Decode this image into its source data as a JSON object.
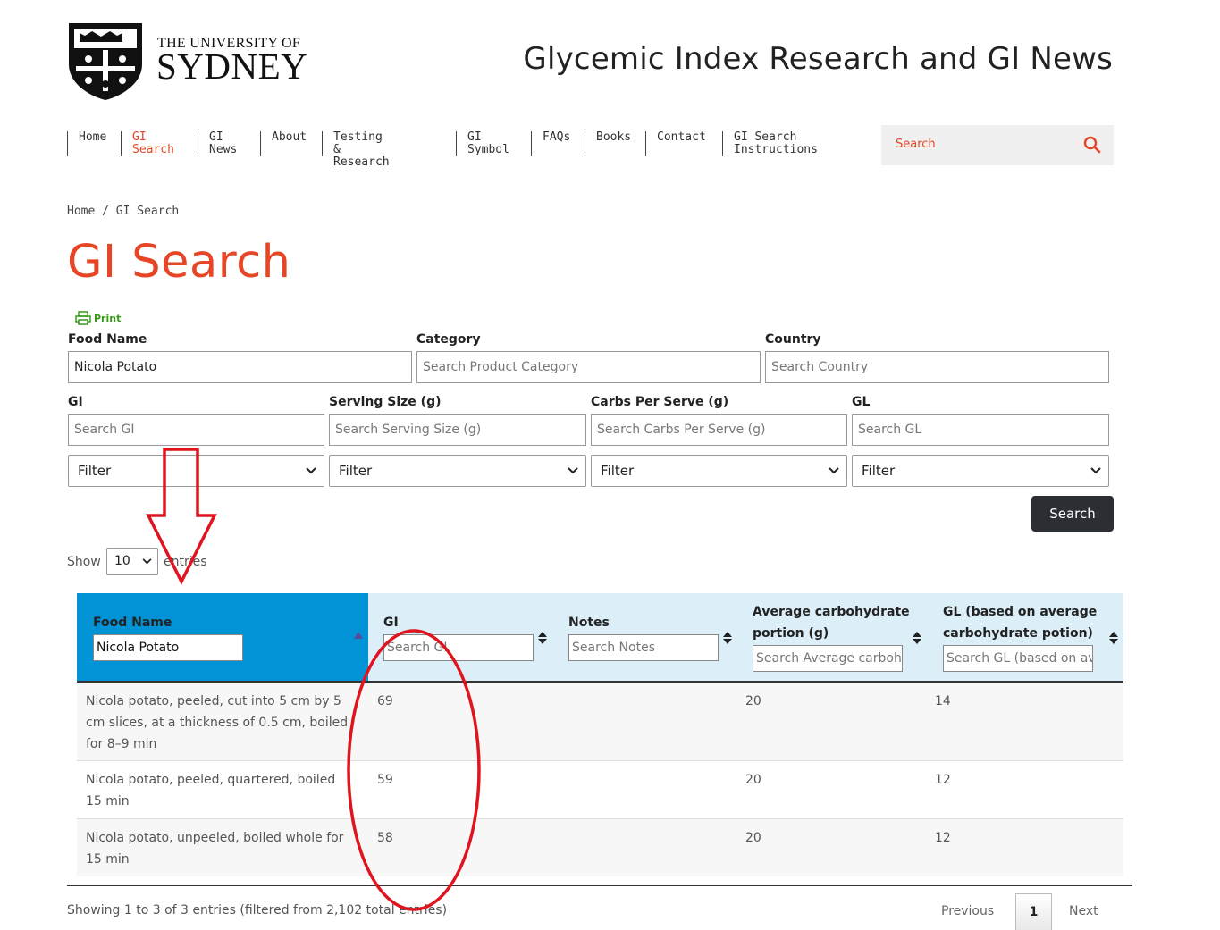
{
  "header": {
    "logo_line1": "THE UNIVERSITY OF",
    "logo_line2": "SYDNEY",
    "site_title": "Glycemic Index Research and GI News"
  },
  "nav": {
    "items": [
      {
        "label": "Home",
        "active": false
      },
      {
        "label": "GI\nSearch",
        "active": true
      },
      {
        "label": "GI\nNews",
        "active": false
      },
      {
        "label": "About",
        "active": false
      },
      {
        "label": "Testing &\nResearch",
        "active": false
      },
      {
        "label": "GI\nSymbol",
        "active": false
      },
      {
        "label": "FAQs",
        "active": false
      },
      {
        "label": "Books",
        "active": false
      },
      {
        "label": "Contact",
        "active": false
      },
      {
        "label": "GI Search\nInstructions",
        "active": false
      }
    ],
    "search_placeholder": "Search"
  },
  "breadcrumb": "Home / GI Search",
  "page_title": "GI Search",
  "print_label": "Print",
  "form": {
    "food_name": {
      "label": "Food Name",
      "value": "Nicola Potato"
    },
    "category": {
      "label": "Category",
      "placeholder": "Search Product Category"
    },
    "country": {
      "label": "Country",
      "placeholder": "Search Country"
    },
    "gi": {
      "label": "GI",
      "placeholder": "Search GI",
      "filter": "Filter"
    },
    "serving": {
      "label": "Serving Size (g)",
      "placeholder": "Search Serving Size (g)",
      "filter": "Filter"
    },
    "carbs": {
      "label": "Carbs Per Serve (g)",
      "placeholder": "Search Carbs Per Serve (g)",
      "filter": "Filter"
    },
    "gl": {
      "label": "GL",
      "placeholder": "Search GL",
      "filter": "Filter"
    },
    "search_button": "Search"
  },
  "show_entries": {
    "prefix": "Show",
    "value": "10",
    "suffix": "entries"
  },
  "table": {
    "headers": {
      "food": {
        "label": "Food Name",
        "input_value": "Nicola Potato"
      },
      "gi": {
        "label": "GI",
        "placeholder": "Search GI"
      },
      "notes": {
        "label": "Notes",
        "placeholder": "Search Notes"
      },
      "carb_line1": "Average carbohydrate",
      "carb_line2": "portion (g)",
      "carb_placeholder": "Search Average carbohydrate portion (g)",
      "gl_line1": "GL (based on average",
      "gl_line2": "carbohydrate potion)",
      "gl_placeholder": "Search GL (based on average carbohydrate potion)"
    },
    "rows": [
      {
        "food": "Nicola potato, peeled, cut into 5 cm by 5 cm slices, at a thickness of 0.5 cm, boiled for 8–9 min",
        "gi": "69",
        "notes": "",
        "carb": "20",
        "gl": "14"
      },
      {
        "food": "Nicola potato, peeled, quartered, boiled 15 min",
        "gi": "59",
        "notes": "",
        "carb": "20",
        "gl": "12"
      },
      {
        "food": "Nicola potato, unpeeled, boiled whole for 15 min",
        "gi": "58",
        "notes": "",
        "carb": "20",
        "gl": "12"
      }
    ]
  },
  "footer": {
    "info": "Showing 1 to 3 of 3 entries (filtered from 2,102 total entries)",
    "prev": "Previous",
    "current_page": "1",
    "next": "Next"
  },
  "colors": {
    "accent": "#e64626",
    "header_blue": "#0292d6",
    "header_light": "#dceef8",
    "annotation_red": "#e0141e",
    "button_dark": "#2b2f33"
  }
}
